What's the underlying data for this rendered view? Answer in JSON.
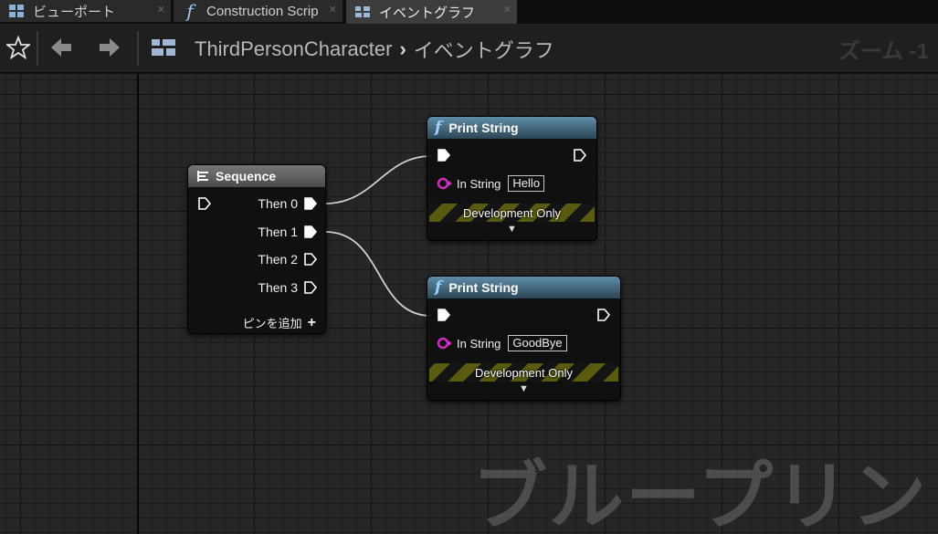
{
  "tabs": [
    {
      "label": "ビューポート",
      "icon": "viewport-icon"
    },
    {
      "label": "Construction Scrip",
      "icon": "function-icon"
    },
    {
      "label": "イベントグラフ",
      "icon": "graph-icon",
      "active": true
    }
  ],
  "breadcrumb": {
    "root": "ThirdPersonCharacter",
    "current": "イベントグラフ"
  },
  "zoom_label": "ズーム -1",
  "watermark": "ブループリント",
  "sequence_node": {
    "title": "Sequence",
    "outputs": [
      "Then 0",
      "Then 1",
      "Then 2",
      "Then 3"
    ],
    "add_pin_label": "ピンを追加"
  },
  "print_nodes": [
    {
      "title": "Print String",
      "in_string_label": "In String",
      "in_string_value": "Hello",
      "dev_only": "Development Only"
    },
    {
      "title": "Print String",
      "in_string_label": "In String",
      "in_string_value": "GoodBye",
      "dev_only": "Development Only"
    }
  ],
  "colors": {
    "exec_pin": "#ffffff",
    "string_pin": "#d030c0",
    "function_header": "#3e6680",
    "sequence_header": "#5a5a5a"
  }
}
